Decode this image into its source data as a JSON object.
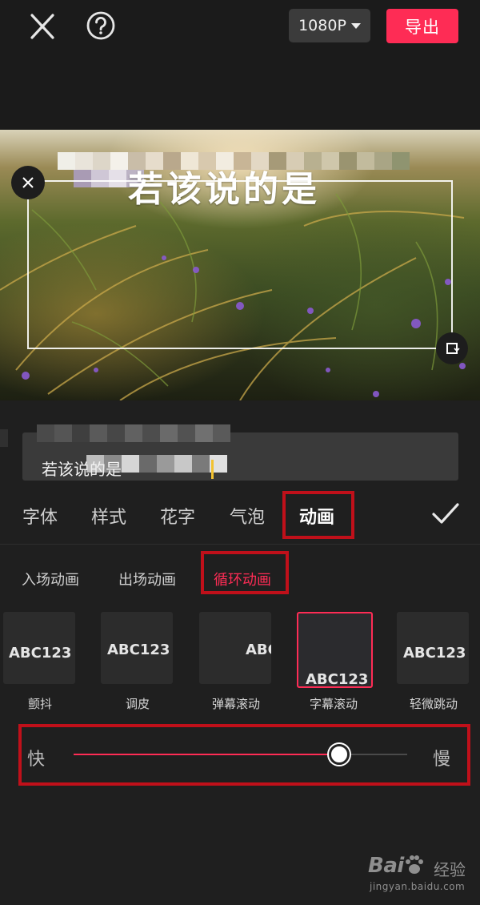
{
  "header": {
    "resolution": "1080P",
    "export_label": "导出"
  },
  "preview": {
    "overlay_text": "若该说的是"
  },
  "text_input": {
    "value": "若该说的是"
  },
  "tabs": [
    {
      "label": "字体",
      "active": false
    },
    {
      "label": "样式",
      "active": false
    },
    {
      "label": "花字",
      "active": false
    },
    {
      "label": "气泡",
      "active": false
    },
    {
      "label": "动画",
      "active": true
    }
  ],
  "sub_tabs": [
    {
      "label": "入场动画",
      "active": false
    },
    {
      "label": "出场动画",
      "active": false
    },
    {
      "label": "循环动画",
      "active": true
    }
  ],
  "presets": [
    {
      "label": "颤抖",
      "sample": "ABC123",
      "selected": false
    },
    {
      "label": "调皮",
      "sample": "ABC123",
      "selected": false
    },
    {
      "label": "弹幕滚动",
      "sample": "ABC",
      "selected": false
    },
    {
      "label": "字幕滚动",
      "sample": "ABC123",
      "selected": true
    },
    {
      "label": "轻微跳动",
      "sample": "ABC123",
      "selected": false
    }
  ],
  "speed": {
    "fast_label": "快",
    "slow_label": "慢",
    "value_fraction": 0.797
  },
  "watermark": {
    "brand": "Bai",
    "brand_cn": "经验",
    "url": "jingyan.baidu.com"
  },
  "colors": {
    "accent": "#fe2c55",
    "highlight": "#c0101a",
    "background": "#1f1f1f"
  }
}
